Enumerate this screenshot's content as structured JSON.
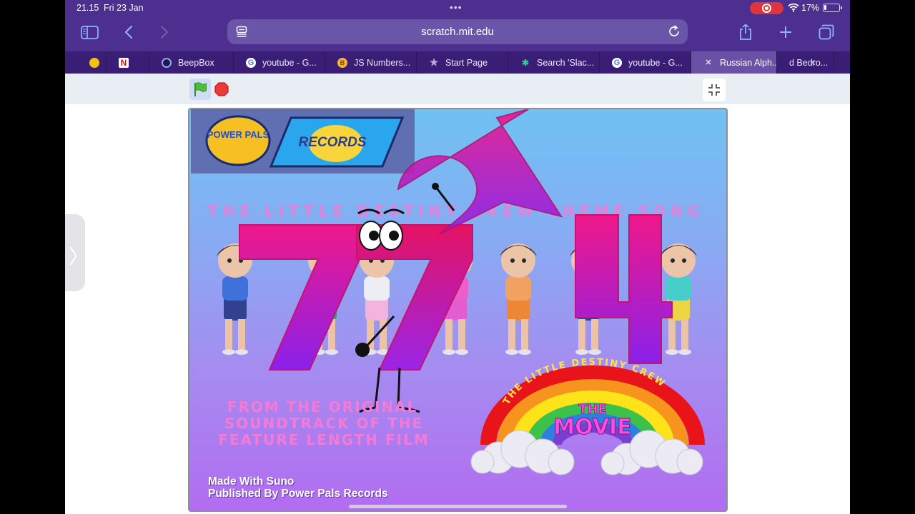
{
  "status_bar": {
    "time": "21.15",
    "date": "Fri 23 Jan",
    "dots": "•••",
    "battery": "17%",
    "battery_level": 0.17
  },
  "toolbar": {
    "url": "scratch.mit.edu"
  },
  "tabs": [
    {
      "label": "",
      "favicon": "google-chrome-icon"
    },
    {
      "label": "",
      "favicon": "netflix-icon"
    },
    {
      "label": "BeepBox",
      "favicon": "beepbox-icon"
    },
    {
      "label": "youtube - G...",
      "favicon": "google-icon"
    },
    {
      "label": "JS Numbers...",
      "favicon": "js-numbers-icon"
    },
    {
      "label": "Start Page",
      "favicon": "star-icon"
    },
    {
      "label": "Search 'Slac...",
      "favicon": "search-slack-icon"
    },
    {
      "label": "youtube - G...",
      "favicon": "google-icon"
    },
    {
      "label": "Russian Alph...",
      "favicon": "close-tab-icon",
      "active": true
    },
    {
      "label": "d Bedro...",
      "favicon": ""
    }
  ],
  "tab_overflow": "x",
  "stage": {
    "logo_left": "POWER PALS",
    "logo_right": "RECORDS",
    "headline": "THE LITTLE DESTINY CREW THEME SONG",
    "soundtrack_lines": [
      "FROM THE ORIGINAL",
      "SOUNDTRACK OF THE",
      "FEATURE LENGTH FILM"
    ],
    "rainbow_arc": "THE LITTLE DESTINY CREW",
    "rainbow_title_1": "THE",
    "rainbow_title_2": "MOVIE",
    "credits": [
      "Made With Suno",
      "Published By Power Pals Records"
    ],
    "numbers": [
      "7",
      "7",
      "2",
      "4"
    ]
  },
  "colors": {
    "toolbar": "#4c2f8e",
    "tabstrip": "#3a1e75",
    "active_tab": "#6a51a6",
    "number_pink": "#f0188a",
    "number_purple": "#8a21ea"
  }
}
